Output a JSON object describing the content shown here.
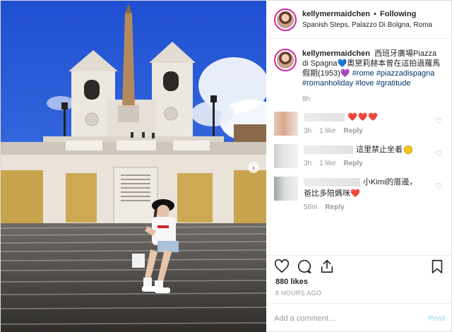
{
  "post": {
    "username": "kellymermaidchen",
    "separator": "•",
    "follow_state": "Following",
    "location": "Spanish Steps, Palazzo Di Bolgna, Roma"
  },
  "caption": {
    "username": "kellymermaidchen",
    "text_1": "西班牙廣場Piazza di Spagna",
    "heart_1": "💙",
    "text_2": "奧黛莉赫本曾在這拍過羅馬假期(1953)",
    "heart_2": "💜",
    "hashtags": [
      "#rome",
      "#piazzadispagna",
      "#romanholiday",
      "#love",
      "#gratitude"
    ],
    "time": "8h"
  },
  "comments": [
    {
      "text": "",
      "hearts": "❤️❤️❤️",
      "time": "3h",
      "likes": "1 like",
      "reply": "Reply"
    },
    {
      "text": "這里禁止坐着",
      "emoji": "😅",
      "time": "3h",
      "likes": "1 like",
      "reply": "Reply"
    },
    {
      "text_1": "小Kimi的厝邊，",
      "text_2": "爸比多陪媽咪",
      "heart": "❤️",
      "time": "58m",
      "reply": "Reply"
    }
  ],
  "stats": {
    "likes": "880 likes",
    "time_ago": "8 HOURS AGO"
  },
  "composer": {
    "placeholder": "Add a comment…",
    "post_label": "Post"
  },
  "icons": {
    "like": "heart-outline-icon",
    "comment": "speech-bubble-icon",
    "share": "share-icon",
    "save": "bookmark-icon",
    "carousel": "chevron-right-icon"
  },
  "colors": {
    "link": "#003569",
    "muted": "#999999",
    "heart": "#ed4956",
    "post_button": "#b2dffc"
  }
}
